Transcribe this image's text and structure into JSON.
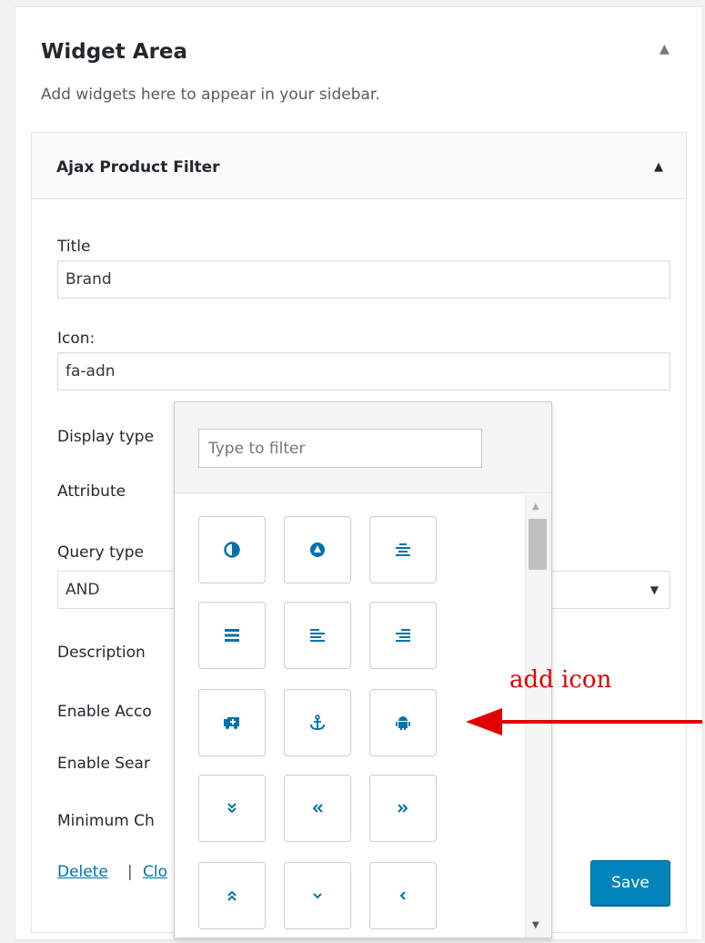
{
  "widget_area": {
    "title": "Widget Area",
    "description": "Add widgets here to appear in your sidebar.",
    "toggle_icon": "triangle-up-icon"
  },
  "widget": {
    "title": "Ajax Product Filter",
    "toggle_icon": "triangle-up-icon",
    "fields": {
      "title_label": "Title",
      "title_value": "Brand",
      "icon_label": "Icon:",
      "icon_value": "fa-adn",
      "display_type_label": "Display type",
      "attribute_label": "Attribute",
      "query_type_label": "Query type",
      "query_type_value": "AND",
      "description_label": "Description",
      "enable_accordion_label": "Enable Acco",
      "enable_search_label": "Enable Sear",
      "minimum_char_label": "Minimum Ch"
    },
    "actions": {
      "delete": "Delete",
      "separator": "|",
      "close": "Clo",
      "save": "Save"
    }
  },
  "icon_picker": {
    "filter_placeholder": "Type to filter",
    "icons": [
      "adjust-icon",
      "adn-icon",
      "align-center-icon",
      "align-justify-icon",
      "align-left-icon",
      "align-right-icon",
      "ambulance-icon",
      "anchor-icon",
      "android-icon",
      "angle-double-down-icon",
      "angle-double-left-icon",
      "angle-double-right-icon",
      "angle-double-up-icon",
      "angle-down-icon",
      "angle-left-icon"
    ]
  },
  "annotation": {
    "text": "add icon",
    "color": "#e00000"
  },
  "colors": {
    "accent": "#0073aa",
    "button": "#0085ba"
  }
}
